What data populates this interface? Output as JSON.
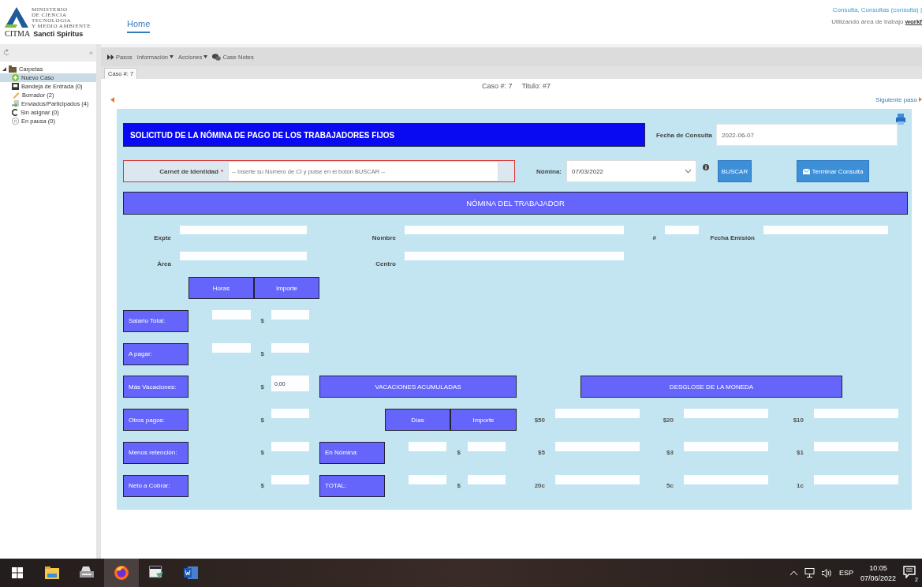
{
  "header": {
    "logo": {
      "lines": [
        "MINISTERIO",
        "DE CIENCIA",
        "TECNOLOGIA",
        "Y MEDIO AMBIENTE"
      ],
      "brand": "CITMA",
      "region": "Sancti Spiritus"
    },
    "nav": [
      {
        "label": "Home",
        "selected": true
      }
    ],
    "user": "Consulta, Consultas (consulta) |",
    "workspace_label": "Utilizando área de trabajo",
    "workspace": "workf"
  },
  "sidebar": {
    "collapse": "«",
    "tree": [
      {
        "label": "Carpetas",
        "kind": "folder",
        "expanded": true,
        "selected": false,
        "children": [
          {
            "label": "Nuevo Caso",
            "kind": "new",
            "selected": true
          },
          {
            "label": "Bandeja de Entrada (0)",
            "kind": "inbox",
            "selected": false
          },
          {
            "label": "Borrador (2)",
            "kind": "draft",
            "selected": false
          },
          {
            "label": "Enviados/Participados (4)",
            "kind": "sent",
            "selected": false
          },
          {
            "label": "Sin asignar (0)",
            "kind": "unassigned",
            "selected": false
          },
          {
            "label": "En pausa (0)",
            "kind": "paused",
            "selected": false
          }
        ]
      }
    ]
  },
  "toolbar": [
    {
      "label": "Pasos",
      "kind": "steps"
    },
    {
      "label": "Información",
      "kind": "menu"
    },
    {
      "label": "Acciones",
      "kind": "menu"
    },
    {
      "label": "Case Notes",
      "kind": "notes"
    }
  ],
  "tabs": [
    {
      "label": "Caso #: 7",
      "selected": true
    }
  ],
  "case_header": {
    "case": "Caso #: 7",
    "title": "Titulo: #7"
  },
  "next_step": "Siguiente paso",
  "form": {
    "title": "SOLICITUD DE LA NÓMINA DE PAGO DE LOS TRABAJADORES FIJOS",
    "fecha_consulta": {
      "label": "Fecha de Consulta",
      "value": "2022-06-07"
    },
    "carnet": {
      "label": "Carnet de Identidad",
      "required_mark": "*",
      "placeholder": "-- Inserte su Número de CI y pulse en el botón BUSCAR --"
    },
    "nomina": {
      "label": "Nómina:",
      "value": "07/03/2022"
    },
    "buttons": [
      {
        "label": "BUSCAR",
        "kind": "plain"
      },
      {
        "label": "Terminar Consulta",
        "kind": "mail"
      }
    ],
    "section": "NÓMINA DEL TRABAJADOR",
    "worker_fields": [
      [
        {
          "label": "Expte"
        },
        {
          "label": "Nombre"
        },
        {
          "label": "#"
        },
        {
          "label": "Fecha Emisión"
        }
      ],
      [
        {
          "label": "Área"
        },
        {
          "label": "Centro"
        }
      ]
    ],
    "pay_columns": [
      "Horas",
      "Importe"
    ],
    "pay_rows": [
      {
        "label": "Salario Total:",
        "hours_field": true,
        "currency": "$"
      },
      {
        "label": "A pagar:",
        "hours_field": true,
        "currency": "$"
      },
      {
        "label": "Más Vacaciones:",
        "hours_field": false,
        "currency": "$",
        "value": "0,00"
      },
      {
        "label": "Otros pagos:",
        "hours_field": false,
        "currency": "$"
      },
      {
        "label": "Menos retención:",
        "hours_field": false,
        "currency": "$"
      },
      {
        "label": "Neto a Cobrar:",
        "hours_field": false,
        "currency": "$"
      }
    ],
    "vacaciones": {
      "title": "VACACIONES ACUMULADAS",
      "columns": [
        "Días",
        "Importe"
      ],
      "rows": [
        {
          "label": "En Nómina:",
          "currency": "$"
        },
        {
          "label": "TOTAL:",
          "currency": "$"
        }
      ]
    },
    "desglose": {
      "title": "DESGLOSE DE LA MONEDA",
      "denominations": [
        "$50",
        "$20",
        "$10",
        "$5",
        "$3",
        "$1",
        "20c",
        "5c",
        "1c"
      ]
    }
  },
  "taskbar": {
    "apps": [
      {
        "kind": "windows",
        "active": false
      },
      {
        "kind": "explorer",
        "active": false
      },
      {
        "kind": "scanner",
        "active": false
      },
      {
        "kind": "firefox",
        "active": true
      },
      {
        "kind": "terminal",
        "active": false
      },
      {
        "kind": "word",
        "active": false
      }
    ],
    "lang": "ESP",
    "time": "10:05",
    "date": "07/06/2022",
    "notifications": "2"
  }
}
